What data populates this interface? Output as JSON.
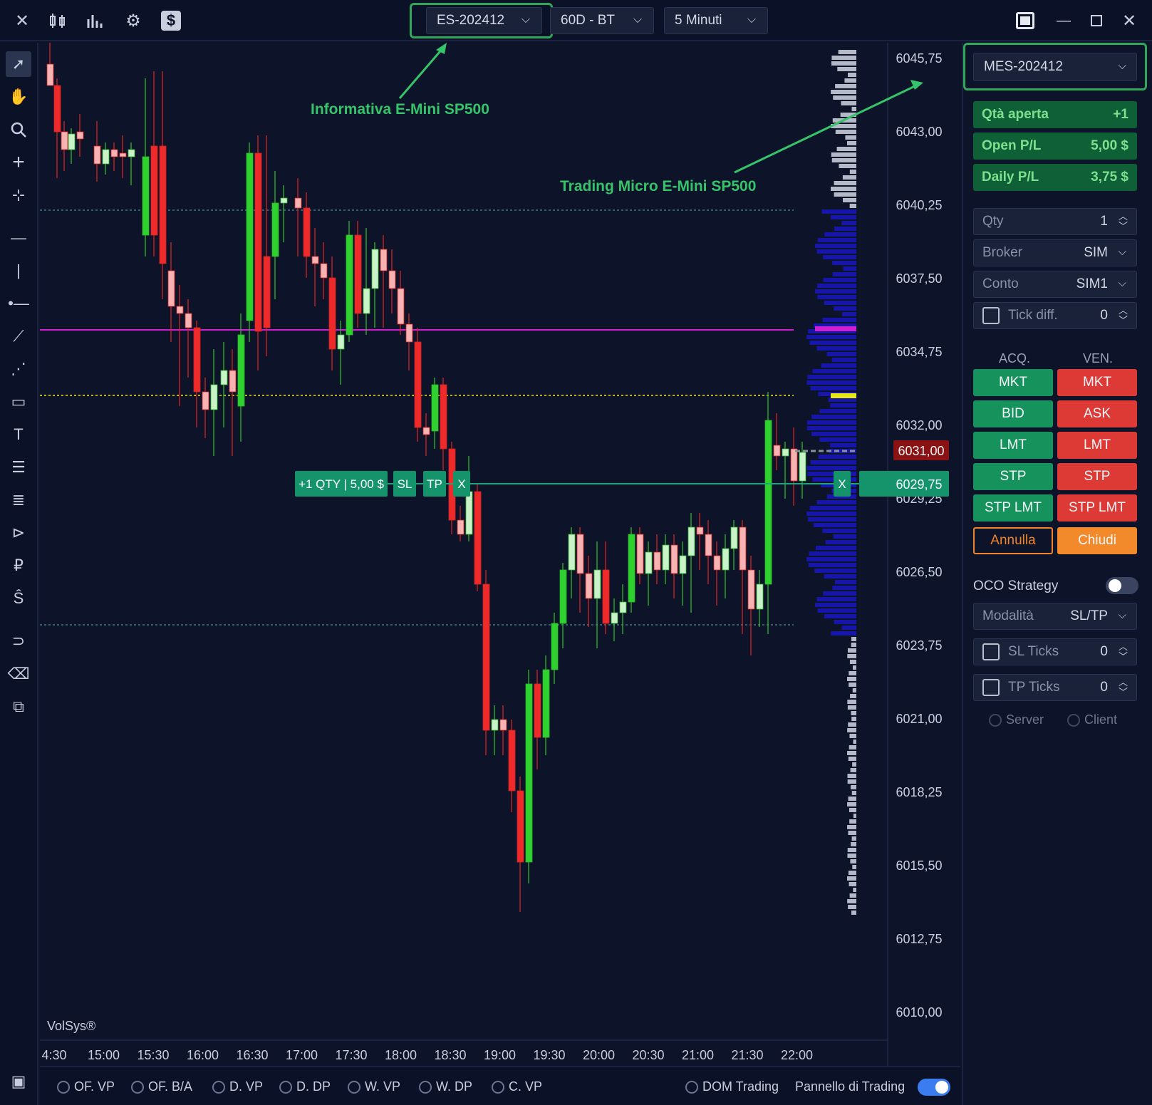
{
  "toolbar": {
    "symbol": "ES-202412",
    "period": "60D - BT",
    "timeframe": "5 Minuti"
  },
  "annotations": {
    "es_label": "Informativa E-Mini SP500",
    "mes_label": "Trading Micro E-Mini SP500"
  },
  "chart": {
    "price_labels": [
      "6045,75",
      "6043,00",
      "6040,25",
      "6037,50",
      "6034,75",
      "6032,00",
      "6029,25",
      "6026,50",
      "6023,75",
      "6021,00",
      "6018,25",
      "6015,50",
      "6012,75",
      "6010,00"
    ],
    "time_labels": [
      "4:30",
      "15:00",
      "15:30",
      "16:00",
      "16:30",
      "17:00",
      "17:30",
      "18:00",
      "18:30",
      "19:00",
      "19:30",
      "20:00",
      "20:30",
      "21:00",
      "21:30",
      "22:00"
    ],
    "last_price": "6031,00",
    "position_price": "6029,75",
    "position_label": "+1 QTY | 5,00 $",
    "sl": "SL",
    "tp": "TP",
    "close_x": "X",
    "watermark": "VolSys®",
    "colors": {
      "bull": "#2fd12f",
      "bull_light": "#c9f2c9",
      "bear": "#ef2a2a",
      "bear_light": "#f7b3b3",
      "magenta": "#d11fd1",
      "yellow": "#e6e619",
      "green_line": "#1fa57c"
    }
  },
  "panel": {
    "symbol": "MES-202412",
    "open_qty_label": "Qtà aperta",
    "open_qty_value": "+1",
    "open_pl_label": "Open P/L",
    "open_pl_value": "5,00 $",
    "daily_pl_label": "Daily P/L",
    "daily_pl_value": "3,75 $",
    "qty_label": "Qty",
    "qty_value": "1",
    "broker_label": "Broker",
    "broker_value": "SIM",
    "account_label": "Conto",
    "account_value": "SIM1",
    "tickdiff_label": "Tick diff.",
    "tickdiff_value": "0",
    "buy_header": "ACQ.",
    "sell_header": "VEN.",
    "buttons": [
      "MKT",
      "BID",
      "LMT",
      "STP",
      "STP LMT"
    ],
    "sell_buttons": [
      "MKT",
      "ASK",
      "LMT",
      "STP",
      "STP LMT"
    ],
    "cancel": "Annulla",
    "close": "Chiudi",
    "oco_label": "OCO Strategy",
    "mode_label": "Modalità",
    "mode_value": "SL/TP",
    "sl_ticks_label": "SL Ticks",
    "sl_ticks_value": "0",
    "tp_ticks_label": "TP Ticks",
    "tp_ticks_value": "0",
    "server": "Server",
    "client": "Client"
  },
  "bottom": {
    "options": [
      "OF. VP",
      "OF. B/A",
      "D. VP",
      "D. DP",
      "W. VP",
      "W. DP",
      "C. VP"
    ],
    "dom": "DOM Trading",
    "panel": "Pannello di Trading"
  }
}
